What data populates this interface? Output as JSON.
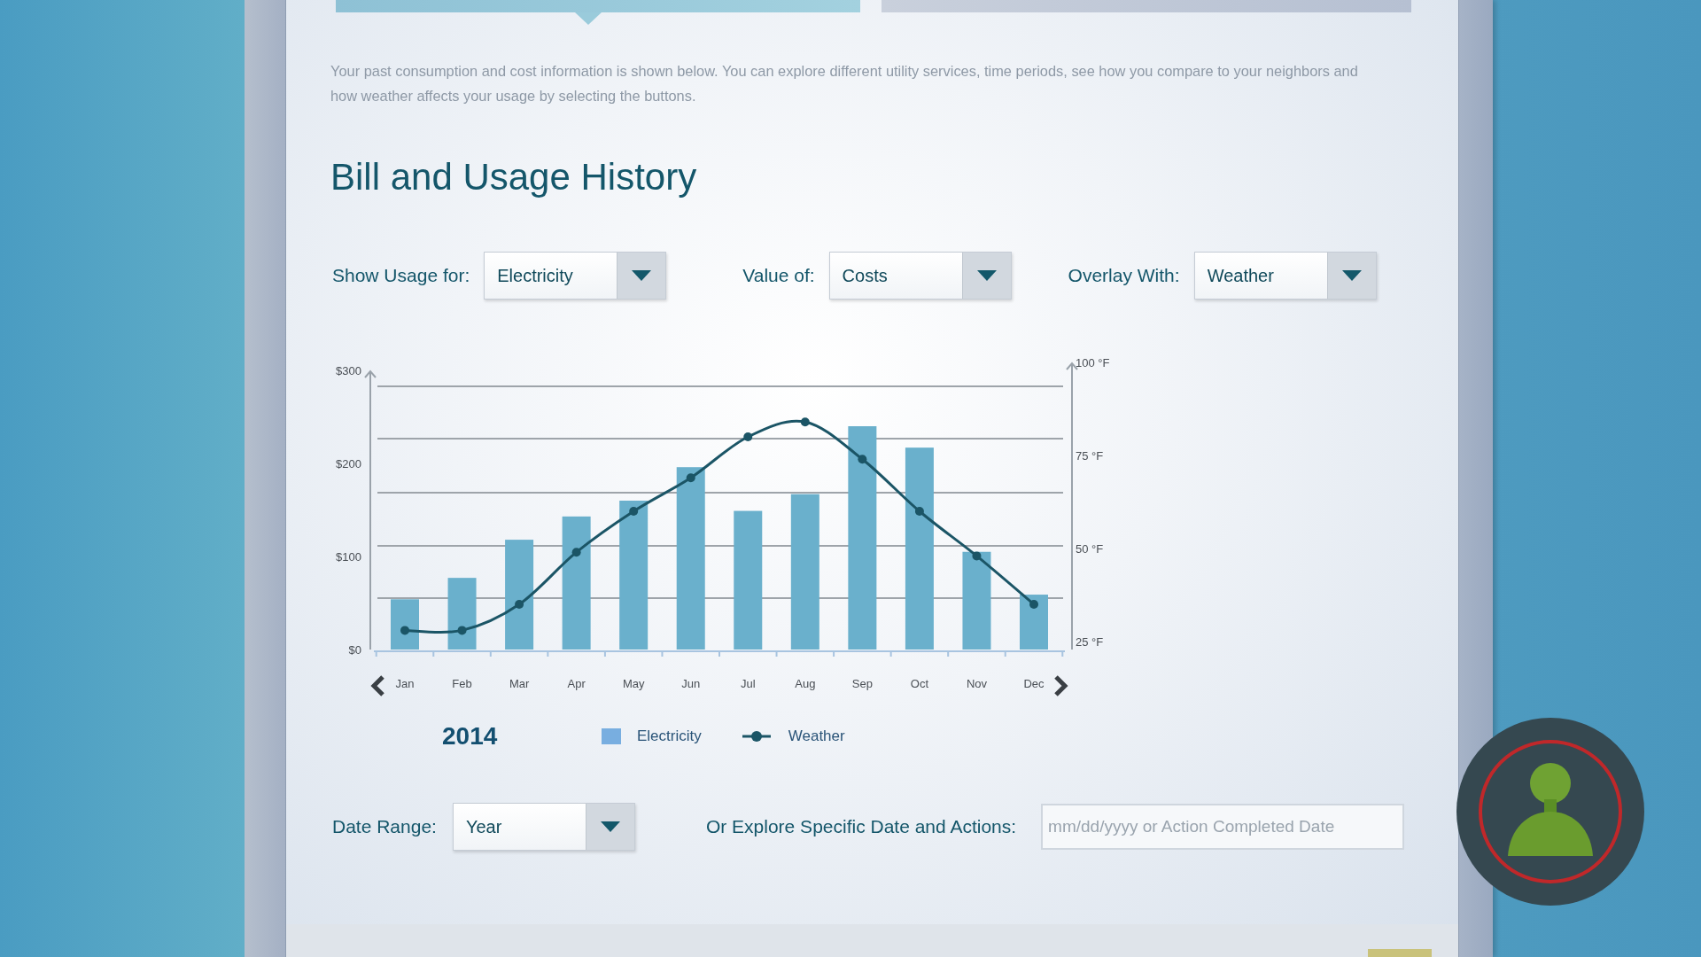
{
  "tabs": [
    {
      "selected": true
    },
    {
      "selected": false
    }
  ],
  "intro": "Your past consumption and cost information is shown below. You can explore different utility services, time periods, see how you compare to your neighbors and how weather affects your usage by selecting the buttons.",
  "title": "Bill and Usage History",
  "filters": [
    {
      "label": "Show Usage for:",
      "value": "Electricity"
    },
    {
      "label": "Value of:",
      "value": "Costs"
    },
    {
      "label": "Overlay With:",
      "value": "Weather"
    }
  ],
  "chart_data": {
    "type": "bar",
    "categories": [
      "Jan",
      "Feb",
      "Mar",
      "Apr",
      "May",
      "Jun",
      "Jul",
      "Aug",
      "Sep",
      "Oct",
      "Nov",
      "Dec"
    ],
    "series": [
      {
        "name": "Electricity",
        "color": "#6ab0cc",
        "values": [
          54,
          77,
          118,
          143,
          160,
          196,
          149,
          167,
          240,
          217,
          105,
          59
        ]
      }
    ],
    "ylim": [
      0,
      300
    ],
    "yticks": [
      {
        "value": 0,
        "label": "$0"
      },
      {
        "value": 100,
        "label": "$100"
      },
      {
        "value": 200,
        "label": "$200"
      },
      {
        "value": 300,
        "label": "$300"
      }
    ]
  },
  "overlay": {
    "chart_data": {
      "type": "line",
      "series": [
        {
          "name": "Weather",
          "color": "#1b5566",
          "marker": "circle",
          "values": [
            28,
            28,
            35,
            49,
            60,
            69,
            80,
            84,
            74,
            60,
            48,
            35
          ]
        }
      ],
      "ylim": [
        25,
        100
      ],
      "yticks": [
        {
          "value": 25,
          "label": "25 °F"
        },
        {
          "value": 50,
          "label": "50 °F"
        },
        {
          "value": 75,
          "label": "75 °F"
        },
        {
          "value": 100,
          "label": "100 °F"
        }
      ]
    }
  },
  "year": "2014",
  "date_range": {
    "label": "Date Range:",
    "value": "Year"
  },
  "explore": {
    "label": "Or Explore Specific Date and Actions:",
    "placeholder": "mm/dd/yyyy or Action Completed Date"
  }
}
